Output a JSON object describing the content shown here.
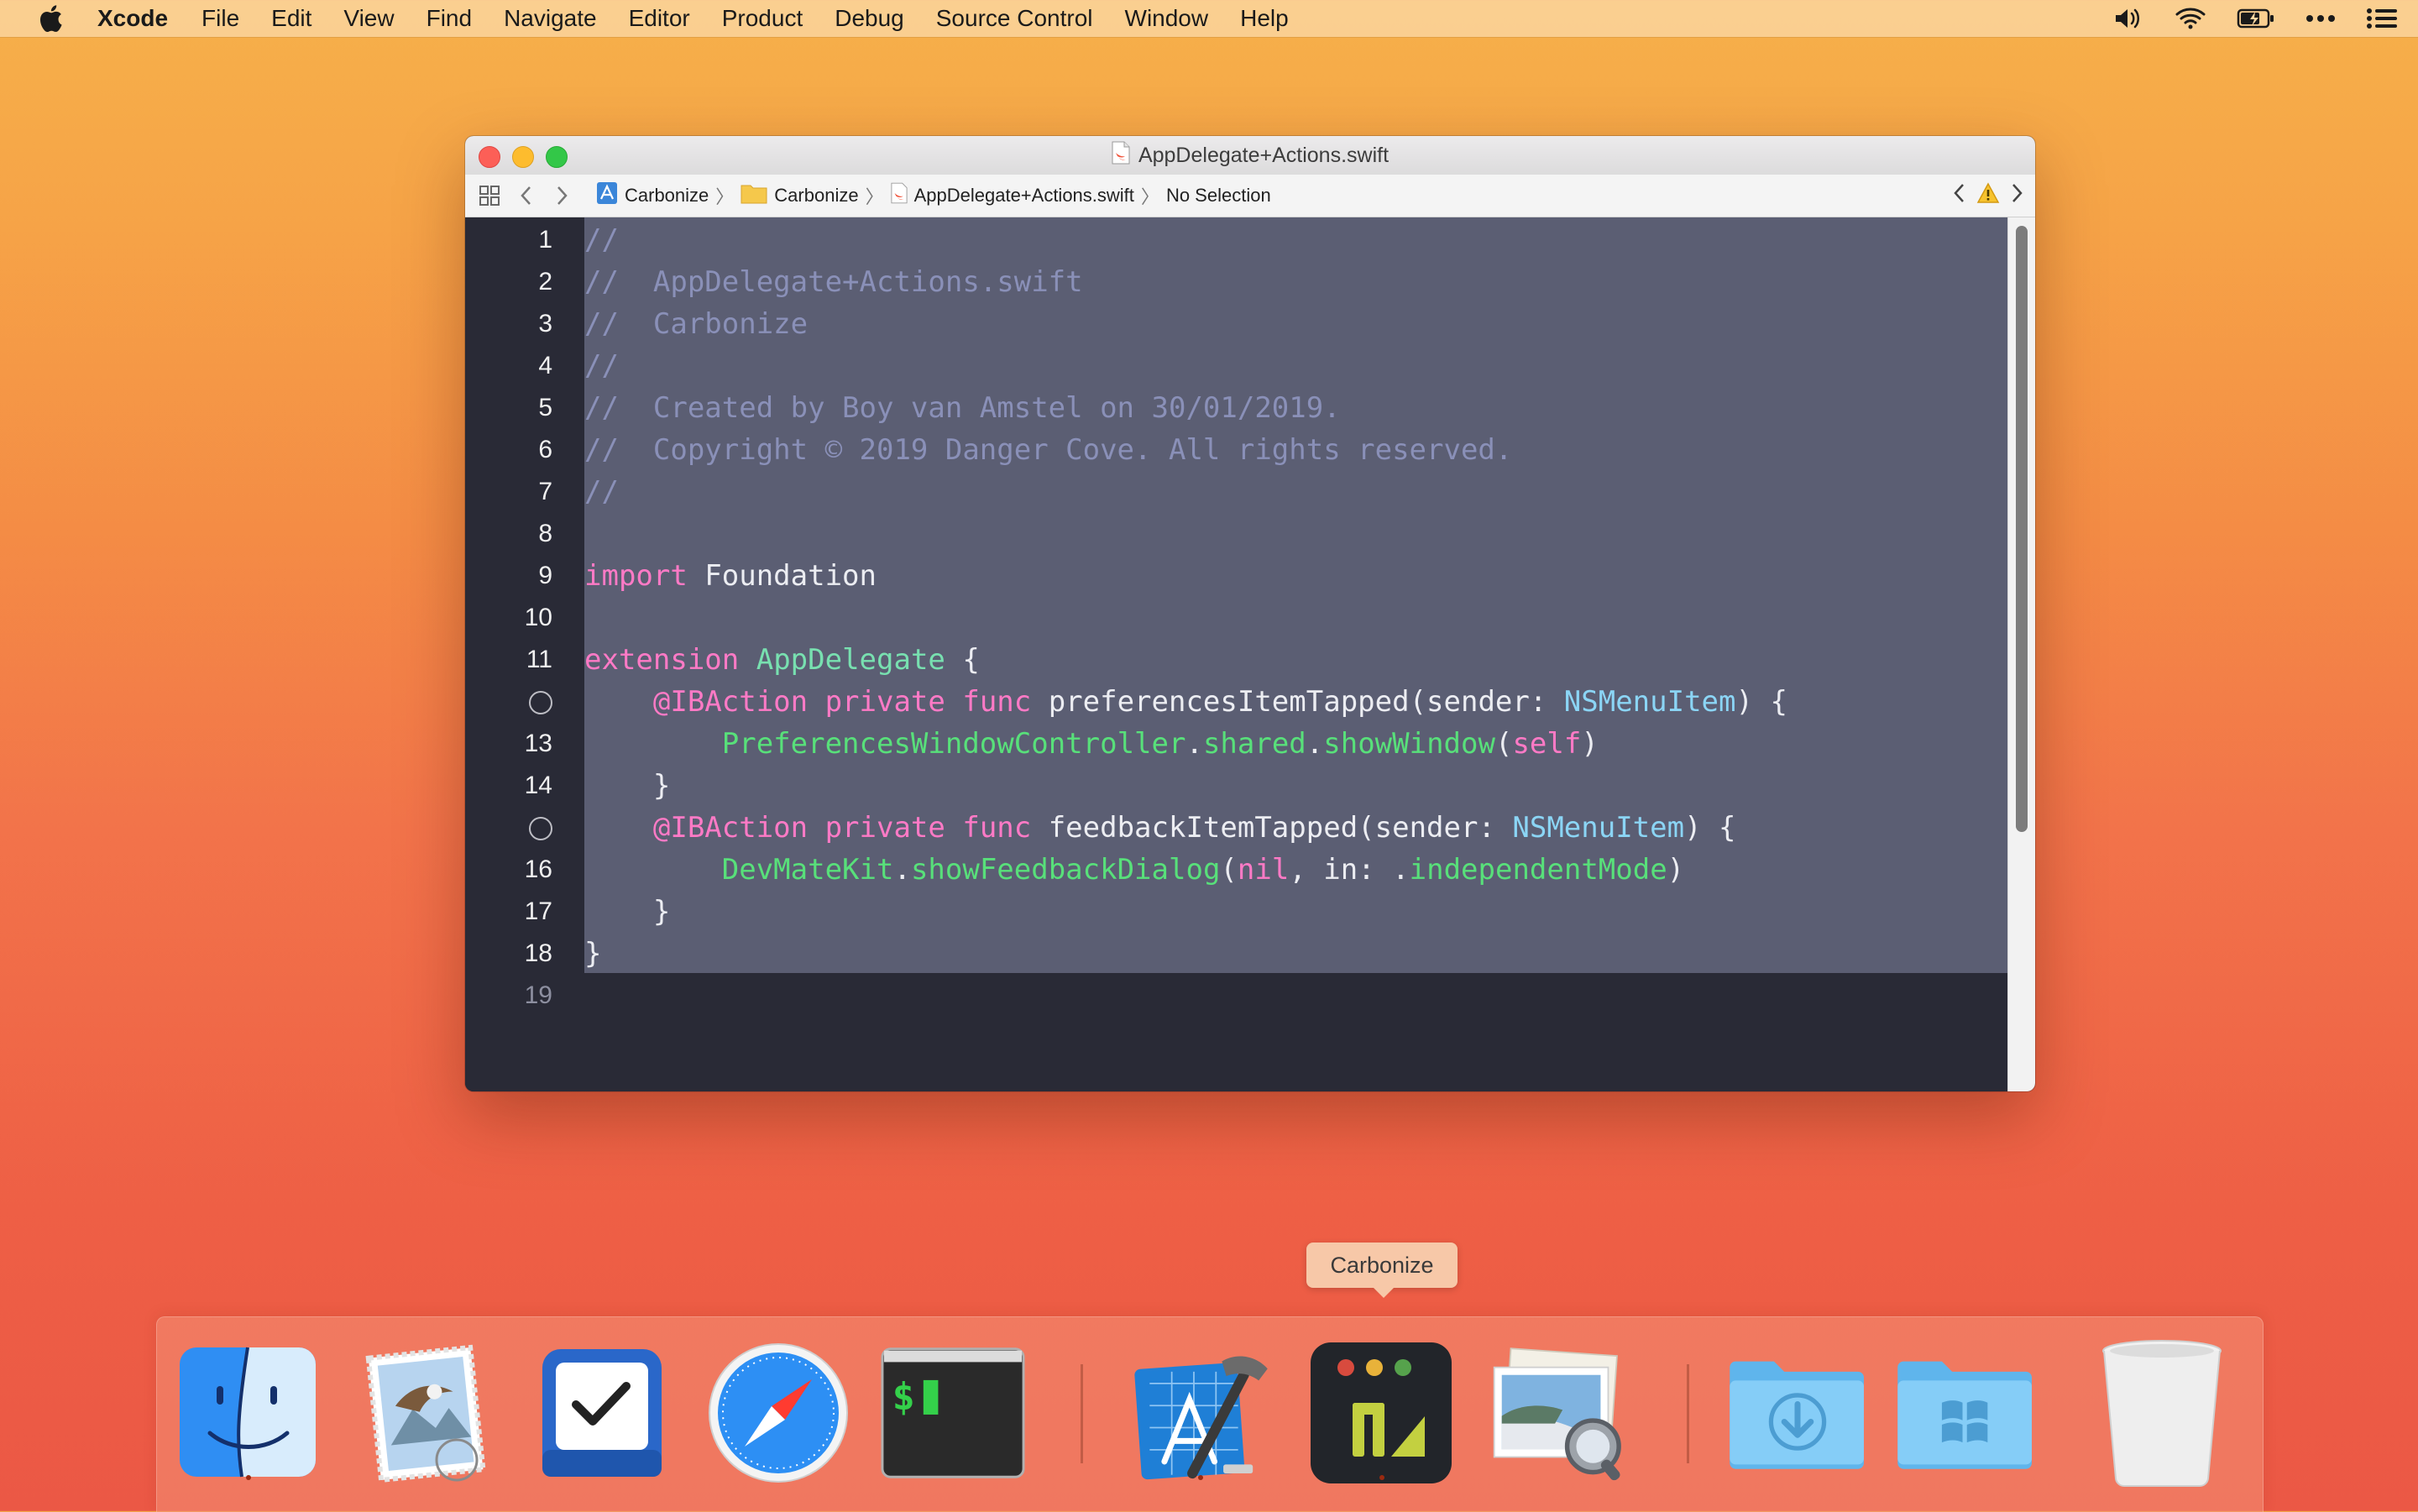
{
  "menubar": {
    "app_name": "Xcode",
    "items": [
      "File",
      "Edit",
      "View",
      "Find",
      "Navigate",
      "Editor",
      "Product",
      "Debug",
      "Source Control",
      "Window",
      "Help"
    ],
    "status_icons": [
      "volume-icon",
      "wifi-icon",
      "battery-icon",
      "more-icon",
      "list-icon"
    ]
  },
  "window": {
    "title": "AppDelegate+Actions.swift",
    "breadcrumb": [
      "Carbonize",
      "Carbonize",
      "AppDelegate+Actions.swift",
      "No Selection"
    ]
  },
  "editor": {
    "lines": [
      {
        "n": "1",
        "t": [
          [
            "c",
            "//"
          ]
        ]
      },
      {
        "n": "2",
        "t": [
          [
            "c",
            "//  AppDelegate+Actions.swift"
          ]
        ]
      },
      {
        "n": "3",
        "t": [
          [
            "c",
            "//  Carbonize"
          ]
        ]
      },
      {
        "n": "4",
        "t": [
          [
            "c",
            "//"
          ]
        ]
      },
      {
        "n": "5",
        "t": [
          [
            "c",
            "//  Created by Boy van Amstel on 30/01/2019."
          ]
        ]
      },
      {
        "n": "6",
        "t": [
          [
            "c",
            "//  Copyright © 2019 Danger Cove. All rights reserved."
          ]
        ]
      },
      {
        "n": "7",
        "t": [
          [
            "c",
            "//"
          ]
        ]
      },
      {
        "n": "8",
        "t": []
      },
      {
        "n": "9",
        "t": [
          [
            "k",
            "import"
          ],
          [
            "i",
            " Foundation"
          ]
        ]
      },
      {
        "n": "10",
        "t": []
      },
      {
        "n": "11",
        "t": [
          [
            "k",
            "extension"
          ],
          [
            "i",
            " "
          ],
          [
            "y",
            "AppDelegate"
          ],
          [
            "i",
            " {"
          ]
        ]
      },
      {
        "n": "",
        "bp": true,
        "t": [
          [
            "i",
            "    "
          ],
          [
            "k",
            "@IBAction private func"
          ],
          [
            "i",
            " preferencesItemTapped(sender: "
          ],
          [
            "s",
            "NSMenuItem"
          ],
          [
            "i",
            ") {"
          ]
        ]
      },
      {
        "n": "13",
        "t": [
          [
            "i",
            "        "
          ],
          [
            "g",
            "PreferencesWindowController"
          ],
          [
            "i",
            "."
          ],
          [
            "g",
            "shared"
          ],
          [
            "i",
            "."
          ],
          [
            "g",
            "showWindow"
          ],
          [
            "i",
            "("
          ],
          [
            "k",
            "self"
          ],
          [
            "i",
            ")"
          ]
        ]
      },
      {
        "n": "14",
        "t": [
          [
            "i",
            "    }"
          ]
        ]
      },
      {
        "n": "",
        "bp": true,
        "t": [
          [
            "i",
            "    "
          ],
          [
            "k",
            "@IBAction private func"
          ],
          [
            "i",
            " feedbackItemTapped(sender: "
          ],
          [
            "s",
            "NSMenuItem"
          ],
          [
            "i",
            ") {"
          ]
        ]
      },
      {
        "n": "16",
        "t": [
          [
            "i",
            "        "
          ],
          [
            "g",
            "DevMateKit"
          ],
          [
            "i",
            "."
          ],
          [
            "g",
            "showFeedbackDialog"
          ],
          [
            "i",
            "("
          ],
          [
            "k",
            "nil"
          ],
          [
            "i",
            ", in: ."
          ],
          [
            "g",
            "independentMode"
          ],
          [
            "i",
            ")"
          ]
        ]
      },
      {
        "n": "17",
        "t": [
          [
            "i",
            "    }"
          ]
        ]
      },
      {
        "n": "18",
        "t": [
          [
            "i",
            "}"
          ]
        ]
      },
      {
        "n": "19",
        "t": []
      }
    ]
  },
  "tooltip": "Carbonize",
  "dock": {
    "items": [
      "Finder",
      "Mail",
      "Things",
      "Safari",
      "Terminal",
      "Xcode",
      "Carbonize",
      "Preview",
      "Downloads",
      "Windows",
      "Trash"
    ]
  }
}
